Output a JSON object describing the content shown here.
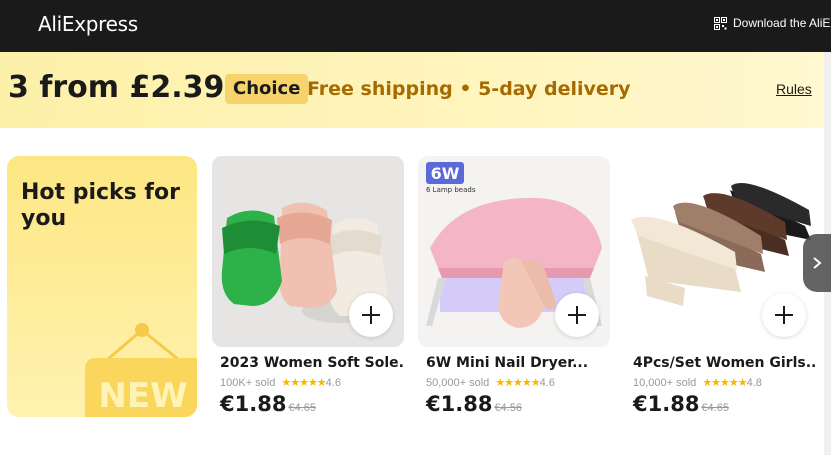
{
  "header": {
    "logo": "AliExpress",
    "download_label": "Download the AliEx"
  },
  "banner": {
    "headline": "3 from £2.39",
    "badge": "Choice",
    "tagline": "Free shipping • 5-day delivery",
    "rules_link": "Rules",
    "accent_color": "#a66b00"
  },
  "hot_picks": {
    "title": "Hot picks for you",
    "sign_text": "NEW"
  },
  "products": [
    {
      "title": "2023 Women Soft Sole...",
      "sold": "100K+ sold",
      "rating": "4.6",
      "rating_value": 4.6,
      "price": "€1.88",
      "old_price": "€4.65",
      "image": "slippers-image"
    },
    {
      "title": "6W Mini Nail Dryer...",
      "sold": "50,000+ sold",
      "rating": "4.6",
      "rating_value": 4.6,
      "price": "€1.88",
      "old_price": "€4.56",
      "image": "nail-dryer-image",
      "image_badge": "6W",
      "image_caption": "6 Lamp beads"
    },
    {
      "title": "4Pcs/Set Women Girls...",
      "sold": "10,000+ sold",
      "rating": "4.8",
      "rating_value": 4.8,
      "price": "€1.88",
      "old_price": "€4.65",
      "image": "hair-claws-image"
    }
  ],
  "icons": {
    "download": "qr-code-icon",
    "add": "plus-icon",
    "next": "chevron-right-icon"
  }
}
